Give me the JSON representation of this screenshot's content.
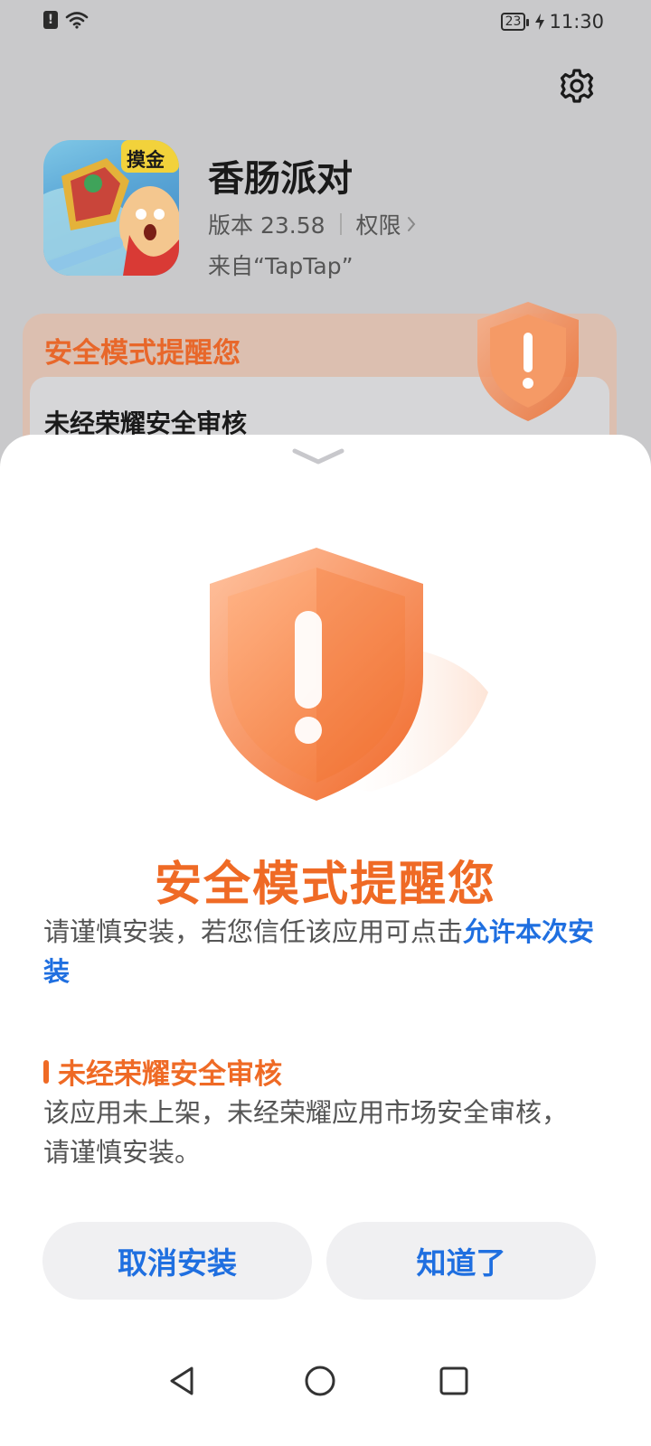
{
  "status_bar": {
    "battery": "23",
    "time": "11:30"
  },
  "app": {
    "name": "香肠派对",
    "version": "版本 23.58",
    "permissions_label": "权限",
    "source": "来自“TapTap”",
    "icon_badge": "摸金"
  },
  "bg_card": {
    "title": "安全模式提醒您",
    "subtitle": "未经荣耀安全审核"
  },
  "sheet": {
    "title": "安全模式提醒您",
    "desc_prefix": "请谨慎安装，若您信任该应用可点击",
    "desc_link": "允许本次安装",
    "warning_title": "未经荣耀安全审核",
    "warning_desc": "该应用未上架，未经荣耀应用市场安全审核，请谨慎安装。",
    "cancel_label": "取消安装",
    "ok_label": "知道了"
  },
  "icons": {
    "settings": "gear-icon",
    "shield": "shield-warning-icon",
    "back": "nav-back-icon",
    "home": "nav-home-icon",
    "recents": "nav-recents-icon"
  },
  "colors": {
    "accent_orange": "#ef6a25",
    "link_blue": "#1f6fe0",
    "overlay_gray": "#c9c9cb",
    "button_bg": "#f0f0f2"
  }
}
